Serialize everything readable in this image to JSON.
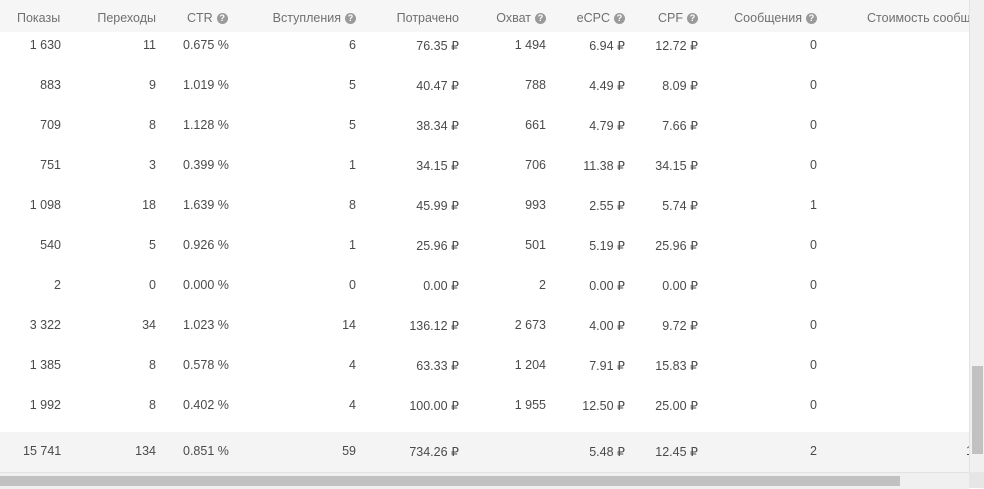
{
  "columns": [
    {
      "key": "shows",
      "label": "Показы",
      "help": false
    },
    {
      "key": "clicks",
      "label": "Переходы",
      "help": false
    },
    {
      "key": "ctr",
      "label": "CTR",
      "help": true
    },
    {
      "key": "joins",
      "label": "Вступления",
      "help": true
    },
    {
      "key": "spent",
      "label": "Потрачено",
      "help": false
    },
    {
      "key": "reach",
      "label": "Охват",
      "help": true
    },
    {
      "key": "ecpc",
      "label": "eCPC",
      "help": true
    },
    {
      "key": "cpf",
      "label": "CPF",
      "help": true
    },
    {
      "key": "messages",
      "label": "Сообщения",
      "help": true
    },
    {
      "key": "msg_cost",
      "label": "Стоимость сообщ",
      "help": true
    }
  ],
  "rows": [
    {
      "shows": "1 630",
      "clicks": "11",
      "ctr": "0.675 %",
      "joins": "6",
      "spent": "76.35 ₽",
      "reach": "1 494",
      "ecpc": "6.94 ₽",
      "cpf": "12.72 ₽",
      "messages": "0"
    },
    {
      "shows": "883",
      "clicks": "9",
      "ctr": "1.019 %",
      "joins": "5",
      "spent": "40.47 ₽",
      "reach": "788",
      "ecpc": "4.49 ₽",
      "cpf": "8.09 ₽",
      "messages": "0"
    },
    {
      "shows": "709",
      "clicks": "8",
      "ctr": "1.128 %",
      "joins": "5",
      "spent": "38.34 ₽",
      "reach": "661",
      "ecpc": "4.79 ₽",
      "cpf": "7.66 ₽",
      "messages": "0"
    },
    {
      "shows": "751",
      "clicks": "3",
      "ctr": "0.399 %",
      "joins": "1",
      "spent": "34.15 ₽",
      "reach": "706",
      "ecpc": "11.38 ₽",
      "cpf": "34.15 ₽",
      "messages": "0"
    },
    {
      "shows": "1 098",
      "clicks": "18",
      "ctr": "1.639 %",
      "joins": "8",
      "spent": "45.99 ₽",
      "reach": "993",
      "ecpc": "2.55 ₽",
      "cpf": "5.74 ₽",
      "messages": "1"
    },
    {
      "shows": "540",
      "clicks": "5",
      "ctr": "0.926 %",
      "joins": "1",
      "spent": "25.96 ₽",
      "reach": "501",
      "ecpc": "5.19 ₽",
      "cpf": "25.96 ₽",
      "messages": "0"
    },
    {
      "shows": "2",
      "clicks": "0",
      "ctr": "0.000 %",
      "joins": "0",
      "spent": "0.00 ₽",
      "reach": "2",
      "ecpc": "0.00 ₽",
      "cpf": "0.00 ₽",
      "messages": "0"
    },
    {
      "shows": "3 322",
      "clicks": "34",
      "ctr": "1.023 %",
      "joins": "14",
      "spent": "136.12 ₽",
      "reach": "2 673",
      "ecpc": "4.00 ₽",
      "cpf": "9.72 ₽",
      "messages": "0"
    },
    {
      "shows": "1 385",
      "clicks": "8",
      "ctr": "0.578 %",
      "joins": "4",
      "spent": "63.33 ₽",
      "reach": "1 204",
      "ecpc": "7.91 ₽",
      "cpf": "15.83 ₽",
      "messages": "0"
    },
    {
      "shows": "1 992",
      "clicks": "8",
      "ctr": "0.402 %",
      "joins": "4",
      "spent": "100.00 ₽",
      "reach": "1 955",
      "ecpc": "12.50 ₽",
      "cpf": "25.00 ₽",
      "messages": "0"
    }
  ],
  "totals": {
    "shows": "15 741",
    "clicks": "134",
    "ctr": "0.851 %",
    "joins": "59",
    "spent": "734.26 ₽",
    "reach": "",
    "ecpc": "5.48 ₽",
    "cpf": "12.45 ₽",
    "messages": "2",
    "msg_cost": "1"
  },
  "help_glyph": "?"
}
